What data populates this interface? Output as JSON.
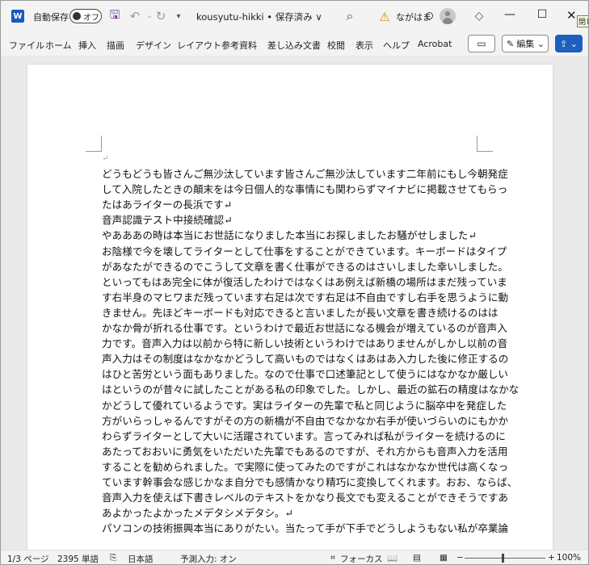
{
  "titlebar": {
    "app_icon": "W",
    "autosave_label": "自動保存",
    "autosave_state": "オフ",
    "doc_title": "kousyutu-hikki • 保存済み ∨",
    "user_name": "ながはま",
    "tooltip": "閉じ"
  },
  "ribbon": {
    "tabs": [
      "ファイル",
      "ホーム",
      "挿入",
      "描画",
      "デザイン",
      "レイアウト",
      "参考資料",
      "差し込み文書",
      "校閲",
      "表示",
      "ヘルプ",
      "Acrobat"
    ],
    "edit_label": "編集 ⌄"
  },
  "document": {
    "lines": [
      "↵",
      "どうもどうも皆さんご無沙汰しています皆さんご無沙汰しています二年前にもし今朝発症",
      "して入院したときの顛末をは今日個人的な事情にも関わらずマイナビに掲載させてもらっ",
      "たはあライターの長浜です↵",
      "音声認識テスト中接続確認↵",
      "やあああの時は本当にお世話になりました本当にお探しましたお騒がせしました↵",
      "お陰様で今を壊してライターとして仕事をすることができています。キーボードはタイプ",
      "があなたができるのでこうして文章を書く仕事ができるのはさいしました幸いしました。",
      "といってもはあ完全に体が復活したわけではなくはあ例えば新橋の場所はまだ残っていま",
      "す右半身のマヒワまだ残っています右足は次です右足は不自由ですし右手を思うように動",
      "きません。先ほどキーボードも対応できると言いましたが長い文章を書き続けるのはは",
      "かなか骨が折れる仕事です。というわけで最近お世話になる機会が増えているのが音声入",
      "力です。音声入力は以前から特に新しい技術というわけではありませんがしかし以前の音",
      "声入力はその制度はなかなかどうして高いものではなくはあはあ入力した後に修正するの",
      "はひと苦労という面もありました。なので仕事で口述筆記として使うにはなかなか厳しい",
      "はというのが昔々に試したことがある私の印象でした。しかし、最近の鉱石の精度はなかな",
      "かどうして優れているようです。実はライターの先輩で私と同じように脳卒中を発症した",
      "方がいらっしゃるんですがその方の新橋が不自由でなかなか右手が使いづらいのにもかか",
      "わらずライターとして大いに活躍されています。言ってみれば私がライターを続けるのに",
      "あたっておおいに勇気をいただいた先輩でもあるのですが、それ方からも音声入力を活用",
      "することを勧められました。で実際に使ってみたのですがこれはなかなか世代は高くなっ",
      "ています幹事会な感じかなま自分でも感情かなり精巧に変換してくれます。おお、ならば、",
      "音声入力を使えば下書きレベルのテキストをかなり長文でも変えることができそうですあ",
      "あよかったよかったメデタシメデタシ。↵",
      "パソコンの技術振興本当にありがたい。当たって手が下手でどうしようもない私が卒業論"
    ]
  },
  "statusbar": {
    "page": "1/3 ページ",
    "words": "2395 単語",
    "language": "日本語",
    "prediction": "予測入力: オン",
    "focus": "フォーカス",
    "zoom": "100%"
  },
  "colors": {
    "accent": "#185abd",
    "share": "#1f5fbf"
  }
}
